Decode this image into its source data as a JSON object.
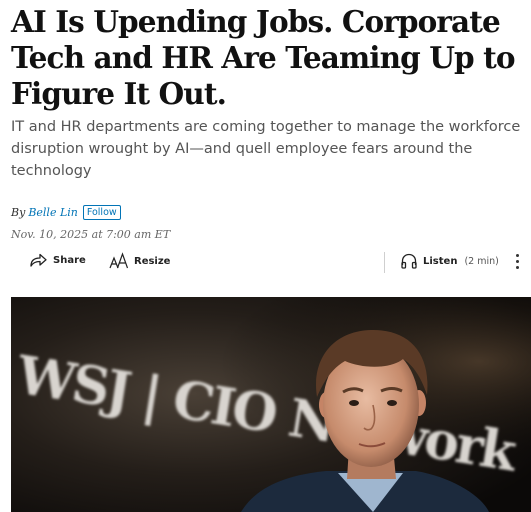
{
  "article": {
    "headline": "AI Is Upending Jobs. Corporate Tech and HR Are Teaming Up to Figure It Out.",
    "dek": "IT and HR departments are coming together to manage the workforce disruption wrought by AI—and quell employee fears around the technology",
    "byline_prefix": "By",
    "author": "Belle Lin",
    "follow_label": "Follow",
    "dateline": "Nov. 10, 2025 at 7:00 am ET"
  },
  "toolbar": {
    "share_label": "Share",
    "share_icon": "share-arrow-icon",
    "resize_label": "Resize",
    "resize_icon": "text-resize-icon",
    "listen_label": "Listen",
    "listen_icon": "headphones-icon",
    "listen_duration": "(2 min)",
    "more_icon": "vertical-ellipsis-icon"
  },
  "hero_image": {
    "backdrop_text": "WSJ | CIO Network"
  },
  "colors": {
    "link_blue": "#0274b6",
    "dek_gray": "#555555",
    "headline_black": "#111111"
  }
}
